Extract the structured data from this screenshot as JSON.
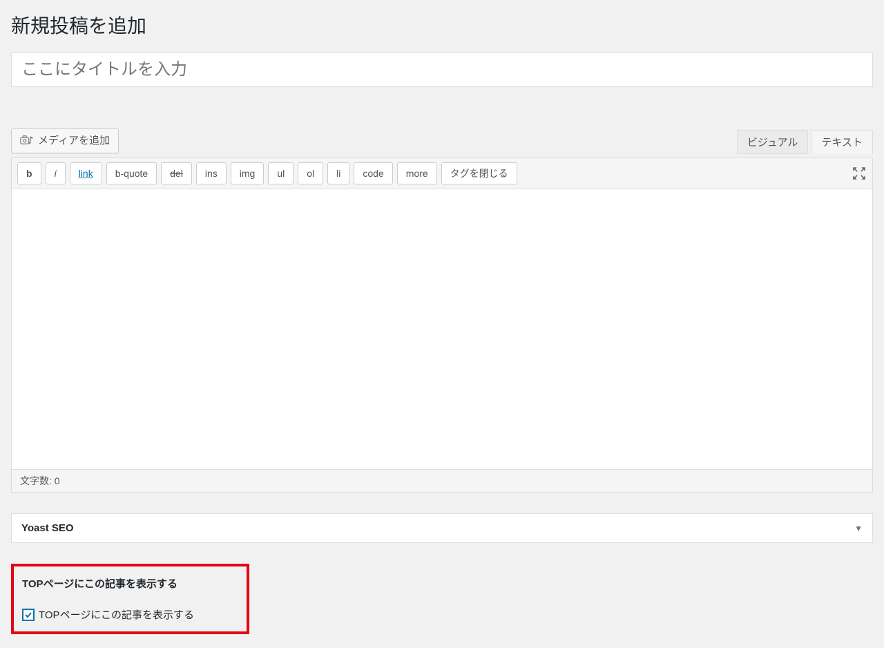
{
  "page": {
    "title": "新規投稿を追加",
    "title_placeholder": "ここにタイトルを入力"
  },
  "media_button": "メディアを追加",
  "tabs": {
    "visual": "ビジュアル",
    "text": "テキスト"
  },
  "toolbar": {
    "b": "b",
    "i": "i",
    "link": "link",
    "bquote": "b-quote",
    "del": "del",
    "ins": "ins",
    "img": "img",
    "ul": "ul",
    "ol": "ol",
    "li": "li",
    "code": "code",
    "more": "more",
    "close_tags": "タグを閉じる"
  },
  "status": {
    "char_count_label": "文字数: 0"
  },
  "yoast": {
    "title": "Yoast SEO"
  },
  "top_box": {
    "heading": "TOPページにこの記事を表示する",
    "checkbox_label": "TOPページにこの記事を表示する",
    "checked": true
  }
}
